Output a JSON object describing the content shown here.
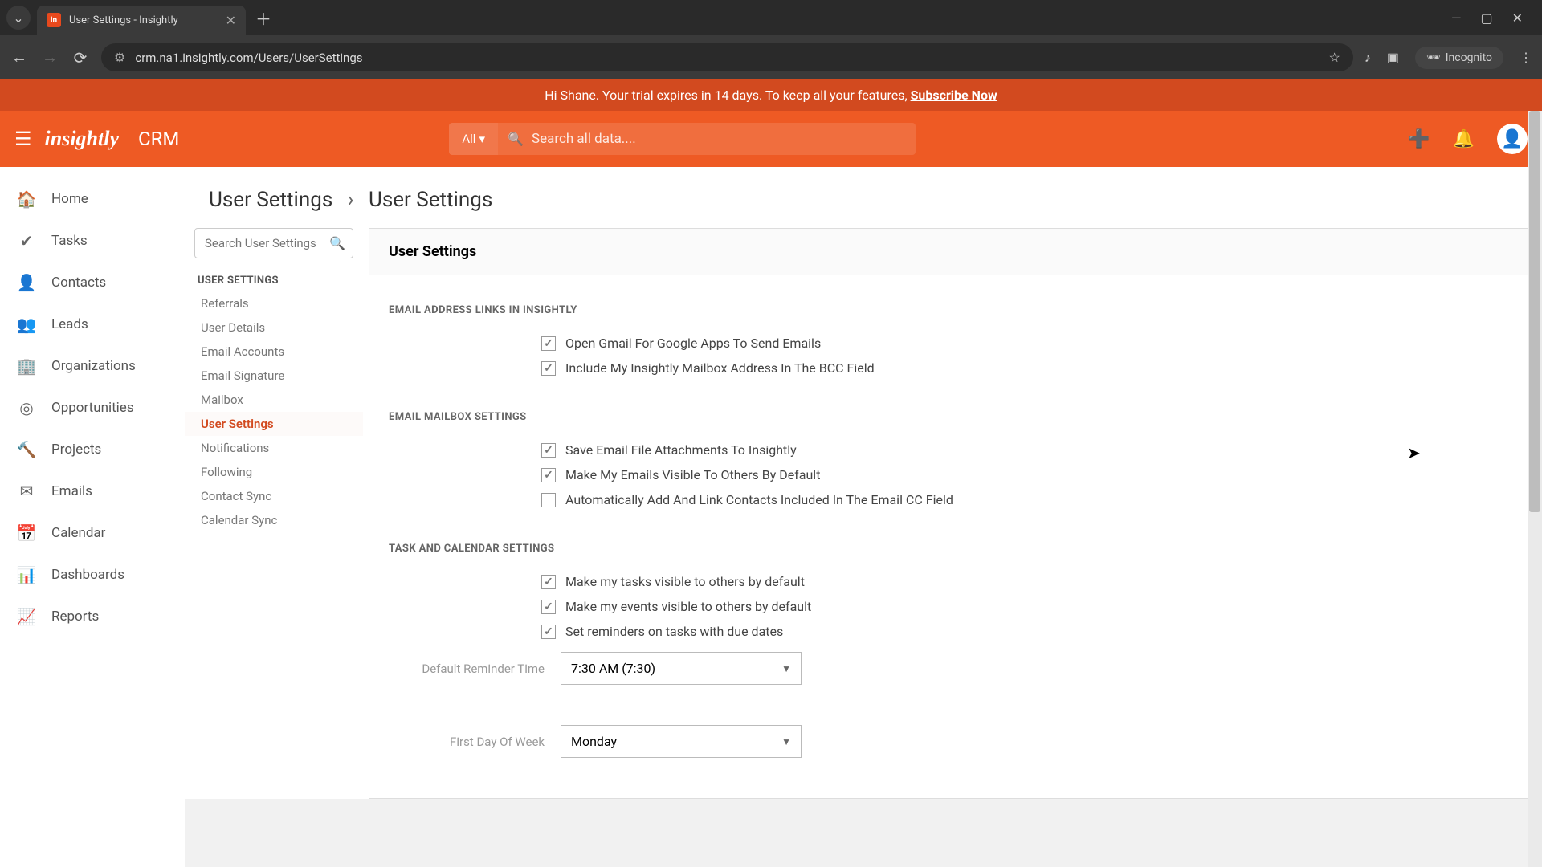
{
  "browser": {
    "tab_title": "User Settings - Insightly",
    "url": "crm.na1.insightly.com/Users/UserSettings",
    "incognito_label": "Incognito"
  },
  "banner": {
    "greeting_prefix": "Hi Shane. Your trial expires in 14 days. To keep all your features, ",
    "subscribe_label": "Subscribe Now"
  },
  "header": {
    "logo_text": "insightly",
    "crm_label": "CRM",
    "search_scope": "All",
    "search_placeholder": "Search all data...."
  },
  "nav": {
    "items": [
      {
        "icon": "🏠",
        "label": "Home"
      },
      {
        "icon": "✔",
        "label": "Tasks"
      },
      {
        "icon": "👤",
        "label": "Contacts"
      },
      {
        "icon": "👥",
        "label": "Leads"
      },
      {
        "icon": "🏢",
        "label": "Organizations"
      },
      {
        "icon": "◎",
        "label": "Opportunities"
      },
      {
        "icon": "🔨",
        "label": "Projects"
      },
      {
        "icon": "✉",
        "label": "Emails"
      },
      {
        "icon": "📅",
        "label": "Calendar"
      },
      {
        "icon": "📊",
        "label": "Dashboards"
      },
      {
        "icon": "📈",
        "label": "Reports"
      }
    ]
  },
  "breadcrumb": {
    "root": "User Settings",
    "current": "User Settings"
  },
  "settings_nav": {
    "search_placeholder": "Search User Settings",
    "category": "USER SETTINGS",
    "items": [
      {
        "label": "Referrals",
        "active": false
      },
      {
        "label": "User Details",
        "active": false
      },
      {
        "label": "Email Accounts",
        "active": false
      },
      {
        "label": "Email Signature",
        "active": false
      },
      {
        "label": "Mailbox",
        "active": false
      },
      {
        "label": "User Settings",
        "active": true
      },
      {
        "label": "Notifications",
        "active": false
      },
      {
        "label": "Following",
        "active": false
      },
      {
        "label": "Contact Sync",
        "active": false
      },
      {
        "label": "Calendar Sync",
        "active": false
      }
    ]
  },
  "panel": {
    "title": "User Settings",
    "sections": {
      "email_links": {
        "title": "EMAIL ADDRESS LINKS IN INSIGHTLY",
        "opts": [
          {
            "label": "Open Gmail For Google Apps To Send Emails",
            "checked": true
          },
          {
            "label": "Include My Insightly Mailbox Address In The BCC Field",
            "checked": true
          }
        ]
      },
      "mailbox": {
        "title": "EMAIL MAILBOX SETTINGS",
        "opts": [
          {
            "label": "Save Email File Attachments To Insightly",
            "checked": true
          },
          {
            "label": "Make My Emails Visible To Others By Default",
            "checked": true
          },
          {
            "label": "Automatically Add And Link Contacts Included In The Email CC Field",
            "checked": false
          }
        ]
      },
      "task_cal": {
        "title": "TASK AND CALENDAR SETTINGS",
        "opts": [
          {
            "label": "Make my tasks visible to others by default",
            "checked": true
          },
          {
            "label": "Make my events visible to others by default",
            "checked": true
          },
          {
            "label": "Set reminders on tasks with due dates",
            "checked": true
          }
        ],
        "reminder_label": "Default Reminder Time",
        "reminder_value": "7:30 AM (7:30)",
        "first_day_label": "First Day Of Week",
        "first_day_value": "Monday"
      }
    }
  }
}
